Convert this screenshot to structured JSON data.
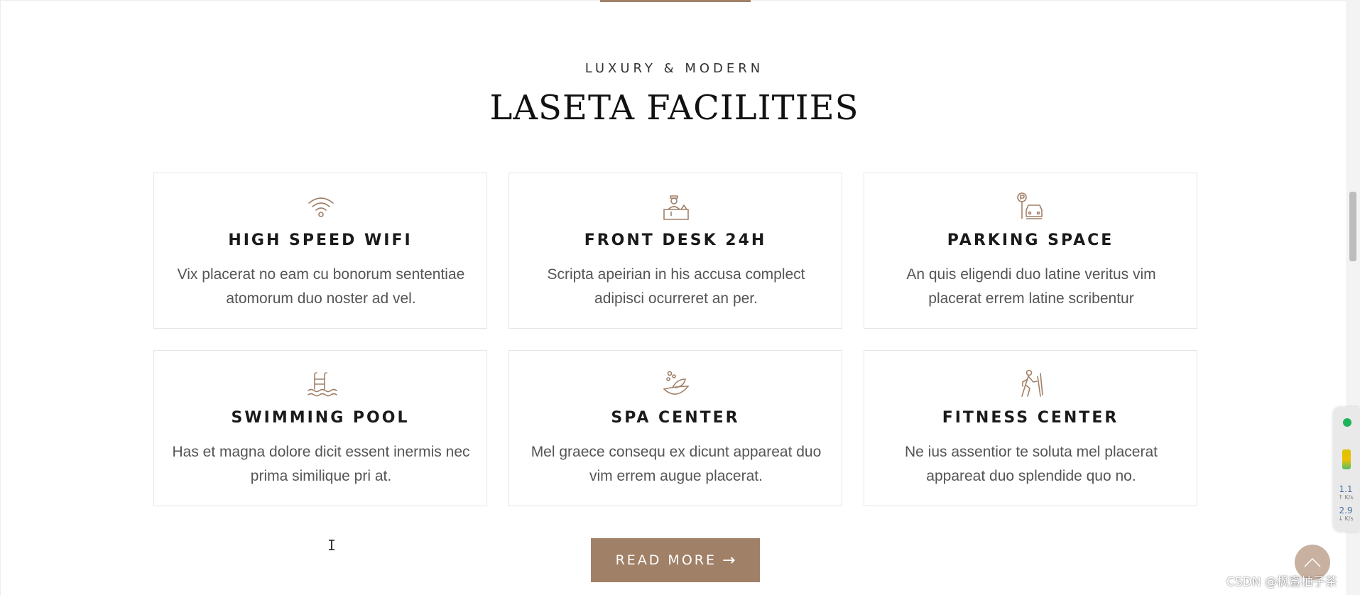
{
  "section": {
    "subtitle": "LUXURY & MODERN",
    "title": "LASETA FACILITIES"
  },
  "facilities": [
    {
      "icon": "wifi-icon",
      "title": "HIGH SPEED WIFI",
      "description": "Vix placerat no eam cu bonorum sententiae atomorum duo noster ad vel."
    },
    {
      "icon": "front-desk-icon",
      "title": "FRONT DESK 24H",
      "description": "Scripta apeirian in his accusa complect adipisci ocurreret an per."
    },
    {
      "icon": "parking-icon",
      "title": "PARKING SPACE",
      "description": "An quis eligendi duo latine veritus vim placerat errem latine scribentur"
    },
    {
      "icon": "swimming-pool-icon",
      "title": "SWIMMING POOL",
      "description": "Has et magna dolore dicit essent inermis nec prima similique pri at."
    },
    {
      "icon": "spa-icon",
      "title": "SPA CENTER",
      "description": "Mel graece consequ ex dicunt appareat duo vim errem augue placerat."
    },
    {
      "icon": "fitness-icon",
      "title": "FITNESS CENTER",
      "description": "Ne ius assentior te soluta mel placerat appareat duo splendide quo no."
    }
  ],
  "read_more": {
    "label": "READ MORE",
    "arrow": "→"
  },
  "monitor": {
    "up_value": "1.1",
    "up_unit": "↑ K/s",
    "down_value": "2.9",
    "down_unit": "↓ K/s"
  },
  "watermark": "CSDN @枫蜜柚子茶",
  "colors": {
    "accent": "#a18068",
    "scroll_top": "#c8b1a1"
  }
}
